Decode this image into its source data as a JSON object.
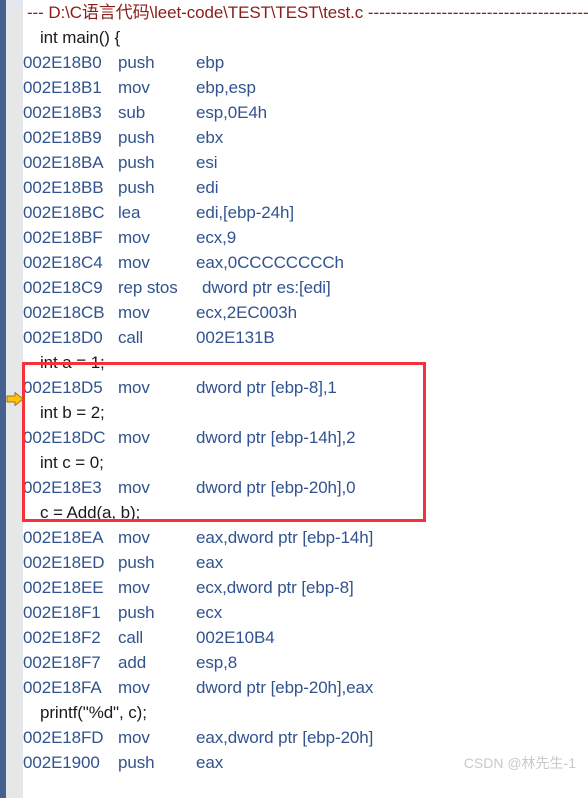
{
  "window": {
    "background": "#ffffff",
    "accent_blue": "#31538f",
    "gutter_bar": "#44608f",
    "gutter_background": "#e6e7e8",
    "header_color": "#8b1d18",
    "annotation_color": "#f4323c",
    "arrow_color": "#ffc20e"
  },
  "banner": {
    "prefix": "--- ",
    "path": "D:\\C语言代码\\leet-code\\TEST\\TEST\\test.c",
    "suffix": " ------------------------------------------"
  },
  "lines": [
    {
      "kind": "src",
      "text": "int main() {"
    },
    {
      "kind": "asm",
      "addr": "002E18B0",
      "mnem": "push",
      "ops": "ebp"
    },
    {
      "kind": "asm",
      "addr": "002E18B1",
      "mnem": "mov",
      "ops": "ebp,esp"
    },
    {
      "kind": "asm",
      "addr": "002E18B3",
      "mnem": "sub",
      "ops": "esp,0E4h"
    },
    {
      "kind": "asm",
      "addr": "002E18B9",
      "mnem": "push",
      "ops": "ebx"
    },
    {
      "kind": "asm",
      "addr": "002E18BA",
      "mnem": "push",
      "ops": "esi"
    },
    {
      "kind": "asm",
      "addr": "002E18BB",
      "mnem": "push",
      "ops": "edi"
    },
    {
      "kind": "asm",
      "addr": "002E18BC",
      "mnem": "lea",
      "ops": "edi,[ebp-24h]"
    },
    {
      "kind": "asm",
      "addr": "002E18BF",
      "mnem": "mov",
      "ops": "ecx,9"
    },
    {
      "kind": "asm",
      "addr": "002E18C4",
      "mnem": "mov",
      "ops": "eax,0CCCCCCCCh"
    },
    {
      "kind": "asm",
      "addr": "002E18C9",
      "mnem": "rep stos",
      "ops": "dword ptr es:[edi]"
    },
    {
      "kind": "asm",
      "addr": "002E18CB",
      "mnem": "mov",
      "ops": "ecx,2EC003h"
    },
    {
      "kind": "asm",
      "addr": "002E18D0",
      "mnem": "call",
      "ops": "002E131B"
    },
    {
      "kind": "src",
      "text": "int a = 1;"
    },
    {
      "kind": "asm",
      "addr": "002E18D5",
      "mnem": "mov",
      "ops": "dword ptr [ebp-8],1"
    },
    {
      "kind": "src",
      "text": "int b = 2;"
    },
    {
      "kind": "asm",
      "addr": "002E18DC",
      "mnem": "mov",
      "ops": "dword ptr [ebp-14h],2"
    },
    {
      "kind": "src",
      "text": "int c = 0;"
    },
    {
      "kind": "asm",
      "addr": "002E18E3",
      "mnem": "mov",
      "ops": "dword ptr [ebp-20h],0"
    },
    {
      "kind": "src",
      "text": "c = Add(a, b);"
    },
    {
      "kind": "asm",
      "addr": "002E18EA",
      "mnem": "mov",
      "ops": "eax,dword ptr [ebp-14h]"
    },
    {
      "kind": "asm",
      "addr": "002E18ED",
      "mnem": "push",
      "ops": "eax"
    },
    {
      "kind": "asm",
      "addr": "002E18EE",
      "mnem": "mov",
      "ops": "ecx,dword ptr [ebp-8]"
    },
    {
      "kind": "asm",
      "addr": "002E18F1",
      "mnem": "push",
      "ops": "ecx"
    },
    {
      "kind": "asm",
      "addr": "002E18F2",
      "mnem": "call",
      "ops": "002E10B4"
    },
    {
      "kind": "asm",
      "addr": "002E18F7",
      "mnem": "add",
      "ops": "esp,8"
    },
    {
      "kind": "asm",
      "addr": "002E18FA",
      "mnem": "mov",
      "ops": "dword ptr [ebp-20h],eax"
    },
    {
      "kind": "src",
      "text": "printf(\"%d\", c);"
    },
    {
      "kind": "asm",
      "addr": "002E18FD",
      "mnem": "mov",
      "ops": "eax,dword ptr [ebp-20h]"
    },
    {
      "kind": "asm",
      "addr": "002E1900",
      "mnem": "push",
      "ops": "eax"
    }
  ],
  "annotation": {
    "label": "red-highlight-rectangle",
    "first_line_index": 13,
    "last_line_index": 18
  },
  "execution_marker": {
    "label": "current-statement-arrow",
    "at_line_index": 14,
    "at_address": "002E18D5"
  },
  "watermark": {
    "text": "CSDN @林先生-1"
  }
}
